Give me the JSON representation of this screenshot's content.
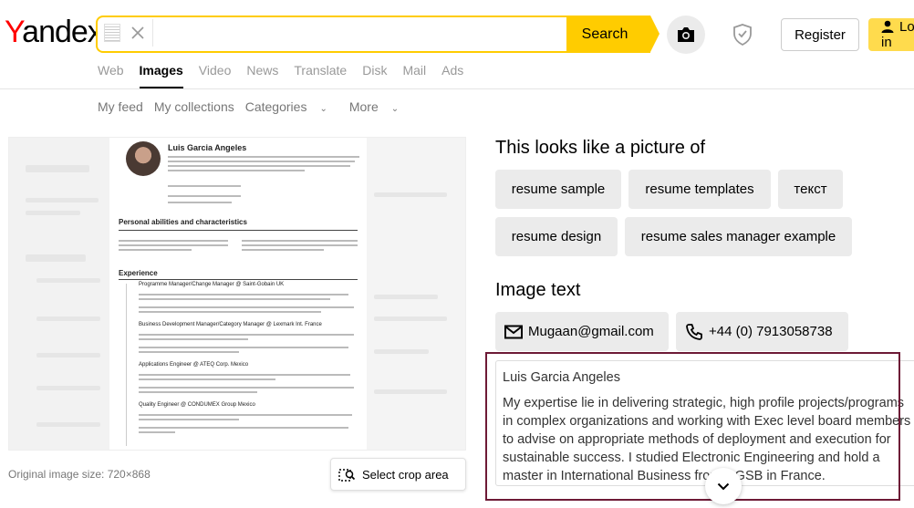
{
  "header": {
    "logo": "Yandex",
    "search_value": "",
    "search_button": "Search",
    "register": "Register",
    "login": "Log in"
  },
  "nav": {
    "tabs": [
      {
        "label": "Web"
      },
      {
        "label": "Images",
        "active": true
      },
      {
        "label": "Video"
      },
      {
        "label": "News"
      },
      {
        "label": "Translate"
      },
      {
        "label": "Disk"
      },
      {
        "label": "Mail"
      },
      {
        "label": "Ads"
      }
    ]
  },
  "subnav": {
    "items": [
      "My feed",
      "My collections",
      "Categories",
      "More"
    ]
  },
  "preview": {
    "resume_name": "Luis Garcia Angeles",
    "section1": "Personal abilities and characteristics",
    "section2": "Experience",
    "job1": "Programme Manager/Change Manager @ Saint-Gobain UK",
    "job2": "Business Development Manager/Category Manager @ Lexmark Int. France",
    "job3": "Applications Engineer @ ATEQ Corp. Mexico",
    "job4": "Quality Engineer @ CONDUMEX Group Mexico"
  },
  "original_size": "Original image size: 720×868",
  "crop_button": "Select crop area",
  "looks_like": {
    "heading": "This looks like a picture of",
    "tags": [
      "resume sample",
      "resume templates",
      "текст",
      "resume design",
      "resume sales manager example"
    ]
  },
  "image_text": {
    "heading": "Image text",
    "email": "Mugaan@gmail.com",
    "phone": "+44 (0) 7913058738",
    "name": "Luis Garcia Angeles",
    "body": "My expertise lie in delivering strategic, high profile projects/programs in complex organizations and working with Exec level board members to advise on appropriate methods of deployment and execution for sustainable success. I studied Electronic Engineering and hold a master in International Business from GGSB in France."
  },
  "colors": {
    "accent_yellow": "#ffcc00",
    "highlight_frame": "#6d1a36"
  },
  "icons": [
    "camera-icon",
    "shield-icon",
    "user-icon",
    "clear-icon",
    "crop-icon",
    "mail-icon",
    "phone-icon",
    "chevron-down-icon"
  ]
}
